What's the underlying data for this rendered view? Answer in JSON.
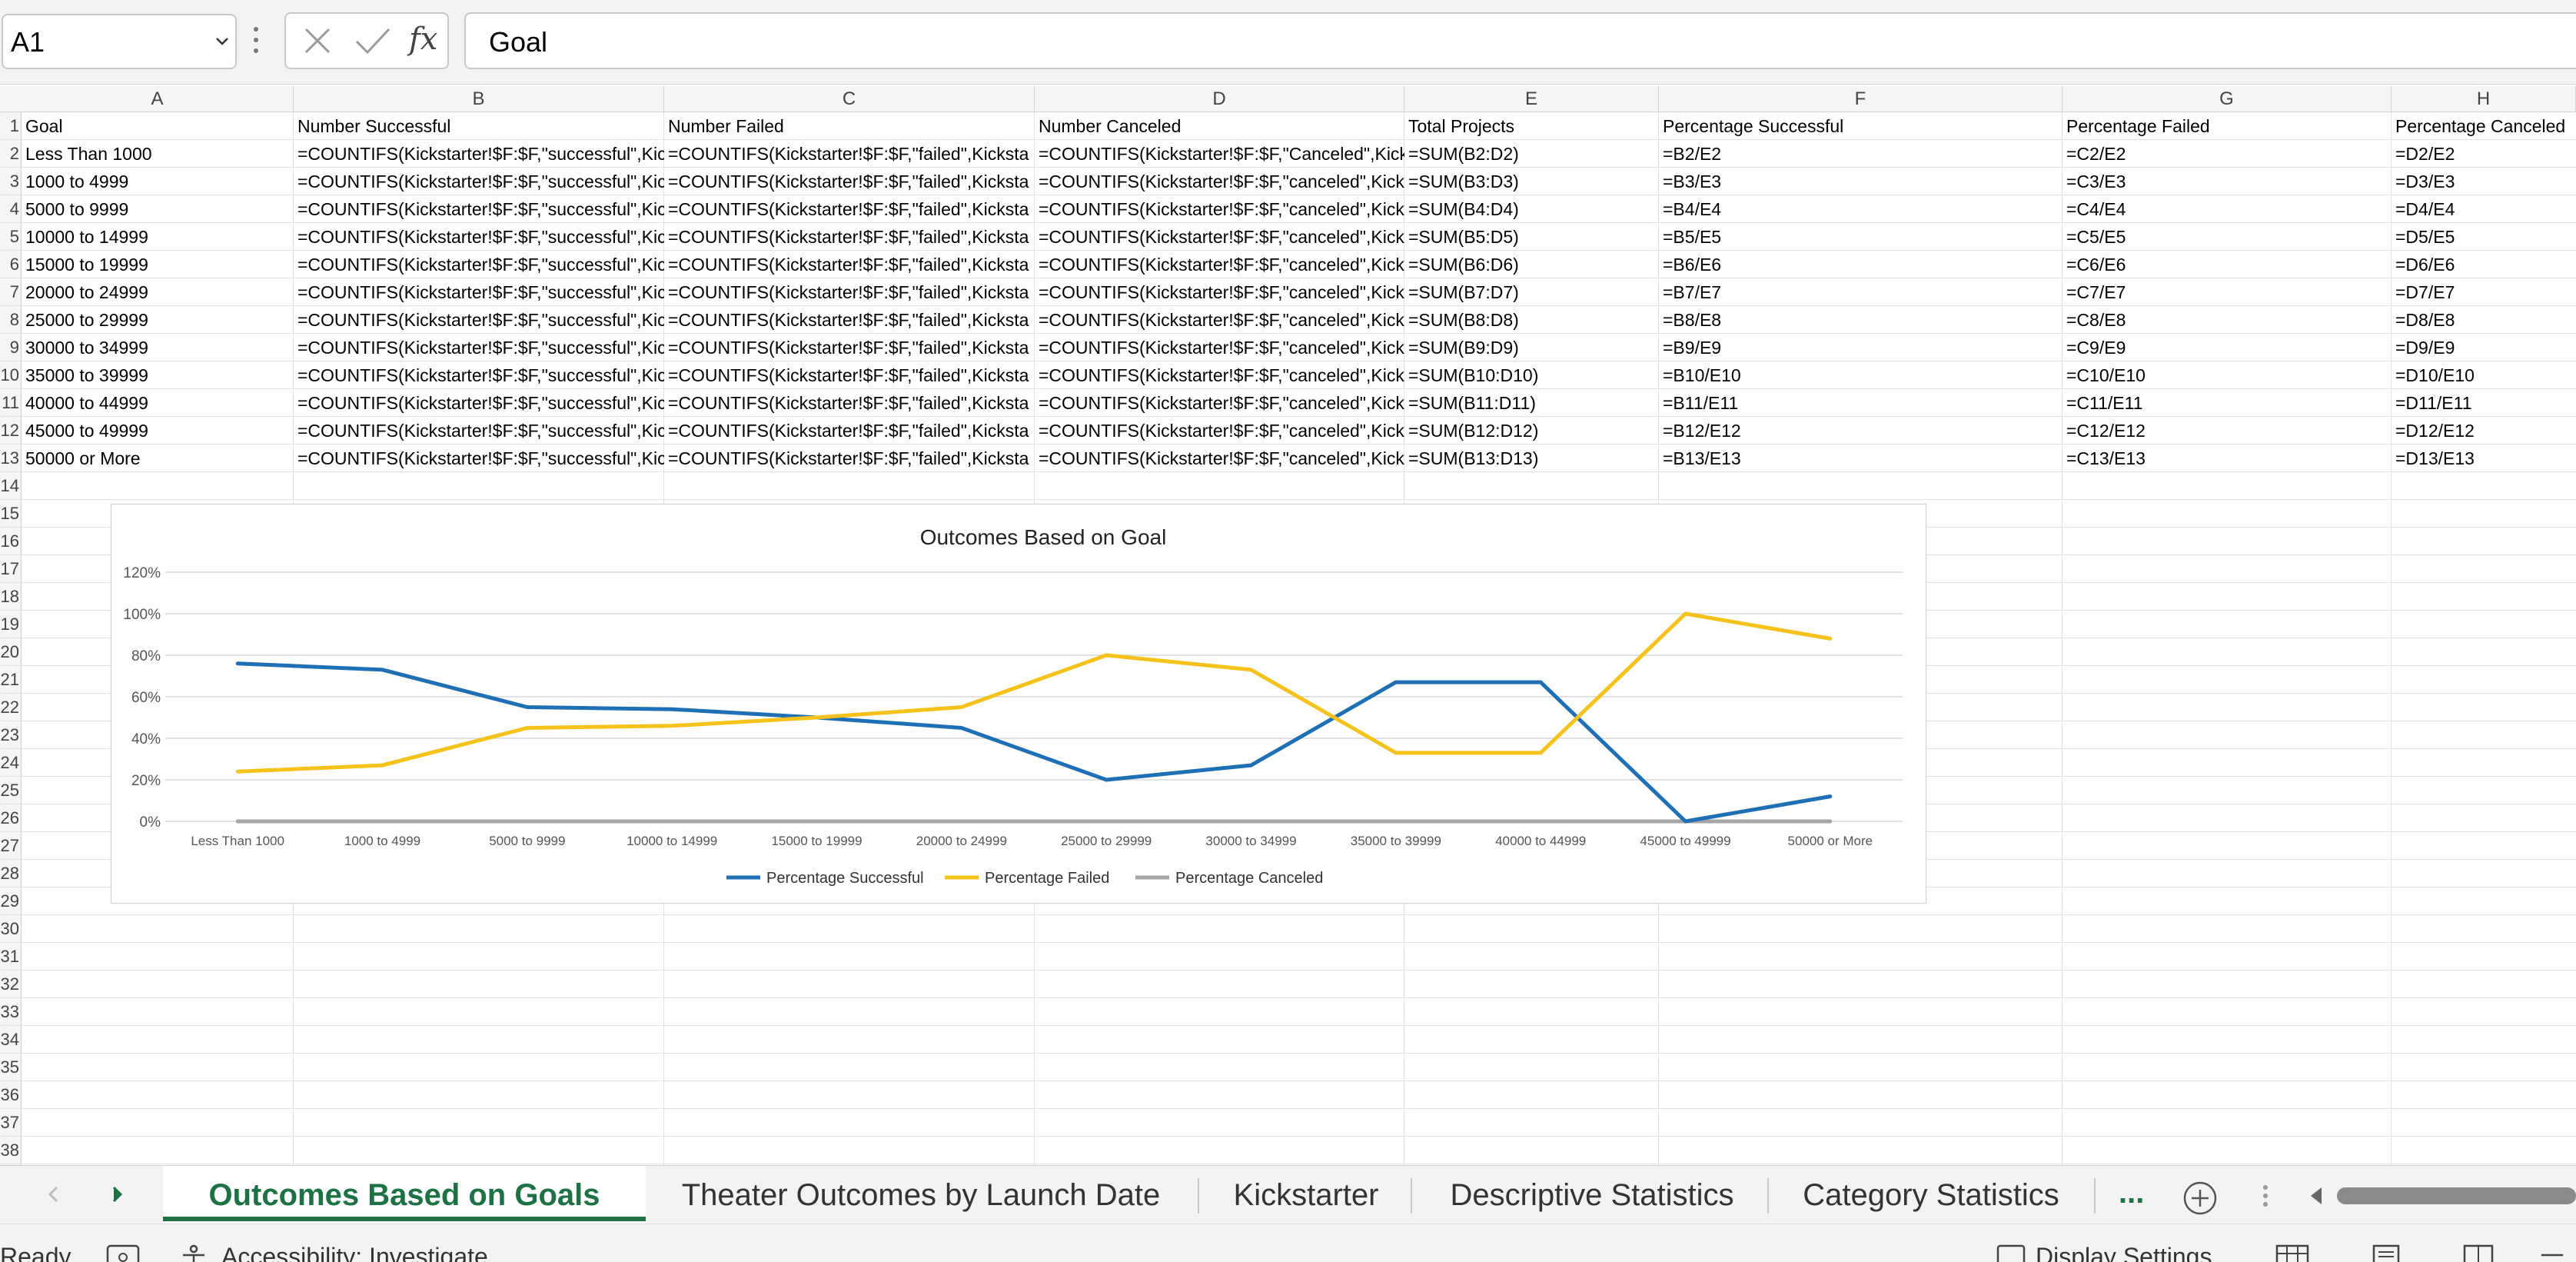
{
  "formula_bar": {
    "name_box": "A1",
    "fx_label": "fx",
    "formula": "Goal"
  },
  "columns": [
    "A",
    "B",
    "C",
    "D",
    "E",
    "F",
    "G",
    "H"
  ],
  "row_numbers": [
    "1",
    "2",
    "3",
    "4",
    "5",
    "6",
    "7",
    "8",
    "9",
    "10",
    "11",
    "12",
    "13",
    "14",
    "15",
    "16",
    "17",
    "18",
    "19",
    "20",
    "21",
    "22",
    "23",
    "24",
    "25",
    "26",
    "27",
    "28",
    "29",
    "30",
    "31",
    "32",
    "33",
    "34",
    "35",
    "36",
    "37",
    "38"
  ],
  "table": {
    "headers": [
      "Goal",
      "Number Successful",
      "Number Failed",
      "Number Canceled",
      "Total Projects",
      "Percentage Successful",
      "Percentage Failed",
      "Percentage Canceled"
    ],
    "rows": [
      [
        "Less Than 1000",
        "=COUNTIFS(Kickstarter!$F:$F,\"successful\",Kic",
        "=COUNTIFS(Kickstarter!$F:$F,\"failed\",Kicksta",
        "=COUNTIFS(Kickstarter!$F:$F,\"Canceled\",Kick",
        "=SUM(B2:D2)",
        "=B2/E2",
        "=C2/E2",
        "=D2/E2"
      ],
      [
        "1000 to 4999",
        "=COUNTIFS(Kickstarter!$F:$F,\"successful\",Kic",
        "=COUNTIFS(Kickstarter!$F:$F,\"failed\",Kicksta",
        "=COUNTIFS(Kickstarter!$F:$F,\"canceled\",Kick",
        "=SUM(B3:D3)",
        "=B3/E3",
        "=C3/E3",
        "=D3/E3"
      ],
      [
        "5000 to 9999",
        "=COUNTIFS(Kickstarter!$F:$F,\"successful\",Kic",
        "=COUNTIFS(Kickstarter!$F:$F,\"failed\",Kicksta",
        "=COUNTIFS(Kickstarter!$F:$F,\"canceled\",Kick",
        "=SUM(B4:D4)",
        "=B4/E4",
        "=C4/E4",
        "=D4/E4"
      ],
      [
        "10000 to 14999",
        "=COUNTIFS(Kickstarter!$F:$F,\"successful\",Kic",
        "=COUNTIFS(Kickstarter!$F:$F,\"failed\",Kicksta",
        "=COUNTIFS(Kickstarter!$F:$F,\"canceled\",Kick",
        "=SUM(B5:D5)",
        "=B5/E5",
        "=C5/E5",
        "=D5/E5"
      ],
      [
        "15000 to 19999",
        "=COUNTIFS(Kickstarter!$F:$F,\"successful\",Kic",
        "=COUNTIFS(Kickstarter!$F:$F,\"failed\",Kicksta",
        "=COUNTIFS(Kickstarter!$F:$F,\"canceled\",Kick",
        "=SUM(B6:D6)",
        "=B6/E6",
        "=C6/E6",
        "=D6/E6"
      ],
      [
        "20000 to 24999",
        "=COUNTIFS(Kickstarter!$F:$F,\"successful\",Kic",
        "=COUNTIFS(Kickstarter!$F:$F,\"failed\",Kicksta",
        "=COUNTIFS(Kickstarter!$F:$F,\"canceled\",Kick",
        "=SUM(B7:D7)",
        "=B7/E7",
        "=C7/E7",
        "=D7/E7"
      ],
      [
        "25000 to 29999",
        "=COUNTIFS(Kickstarter!$F:$F,\"successful\",Kic",
        "=COUNTIFS(Kickstarter!$F:$F,\"failed\",Kicksta",
        "=COUNTIFS(Kickstarter!$F:$F,\"canceled\",Kick",
        "=SUM(B8:D8)",
        "=B8/E8",
        "=C8/E8",
        "=D8/E8"
      ],
      [
        "30000 to 34999",
        "=COUNTIFS(Kickstarter!$F:$F,\"successful\",Kic",
        "=COUNTIFS(Kickstarter!$F:$F,\"failed\",Kicksta",
        "=COUNTIFS(Kickstarter!$F:$F,\"canceled\",Kick",
        "=SUM(B9:D9)",
        "=B9/E9",
        "=C9/E9",
        "=D9/E9"
      ],
      [
        "35000 to 39999",
        "=COUNTIFS(Kickstarter!$F:$F,\"successful\",Kic",
        "=COUNTIFS(Kickstarter!$F:$F,\"failed\",Kicksta",
        "=COUNTIFS(Kickstarter!$F:$F,\"canceled\",Kick",
        "=SUM(B10:D10)",
        "=B10/E10",
        "=C10/E10",
        "=D10/E10"
      ],
      [
        "40000 to 44999",
        "=COUNTIFS(Kickstarter!$F:$F,\"successful\",Kic",
        "=COUNTIFS(Kickstarter!$F:$F,\"failed\",Kicksta",
        "=COUNTIFS(Kickstarter!$F:$F,\"canceled\",Kick",
        "=SUM(B11:D11)",
        "=B11/E11",
        "=C11/E11",
        "=D11/E11"
      ],
      [
        "45000 to 49999",
        "=COUNTIFS(Kickstarter!$F:$F,\"successful\",Kic",
        "=COUNTIFS(Kickstarter!$F:$F,\"failed\",Kicksta",
        "=COUNTIFS(Kickstarter!$F:$F,\"canceled\",Kick",
        "=SUM(B12:D12)",
        "=B12/E12",
        "=C12/E12",
        "=D12/E12"
      ],
      [
        "50000 or More",
        "=COUNTIFS(Kickstarter!$F:$F,\"successful\",Kic",
        "=COUNTIFS(Kickstarter!$F:$F,\"failed\",Kicksta",
        "=COUNTIFS(Kickstarter!$F:$F,\"canceled\",Kick",
        "=SUM(B13:D13)",
        "=B13/E13",
        "=C13/E13",
        "=D13/E13"
      ]
    ]
  },
  "chart_data": {
    "type": "line",
    "title": "Outcomes Based on Goal",
    "categories": [
      "Less Than 1000",
      "1000 to 4999",
      "5000 to 9999",
      "10000 to 14999",
      "15000 to 19999",
      "20000 to 24999",
      "25000 to 29999",
      "30000 to 34999",
      "35000 to 39999",
      "40000 to 44999",
      "45000 to 49999",
      "50000 or More"
    ],
    "series": [
      {
        "name": "Percentage Successful",
        "color": "#1f6fb5",
        "values": [
          0.76,
          0.73,
          0.55,
          0.54,
          0.5,
          0.45,
          0.2,
          0.27,
          0.67,
          0.67,
          0.0,
          0.12
        ]
      },
      {
        "name": "Percentage Failed",
        "color": "#f5c21b",
        "values": [
          0.24,
          0.27,
          0.45,
          0.46,
          0.5,
          0.55,
          0.8,
          0.73,
          0.33,
          0.33,
          1.0,
          0.88
        ]
      },
      {
        "name": "Percentage Canceled",
        "color": "#a6a6a6",
        "values": [
          0,
          0,
          0,
          0,
          0,
          0,
          0,
          0,
          0,
          0,
          0,
          0
        ]
      }
    ],
    "y_ticks": [
      "0%",
      "20%",
      "40%",
      "60%",
      "80%",
      "100%",
      "120%"
    ],
    "ylim": [
      0,
      1.2
    ],
    "grid": true,
    "legend": "bottom"
  },
  "sheet_tabs": {
    "active": "Outcomes Based on Goals",
    "others": [
      "Theater Outcomes by Launch Date",
      "Kickstarter",
      "Descriptive Statistics",
      "Category Statistics"
    ],
    "more_label": "..."
  },
  "status_bar": {
    "ready": "Ready",
    "accessibility": "Accessibility: Investigate",
    "display_settings": "Display Settings"
  },
  "colors": {
    "accent": "#1e7145",
    "successful": "#1f6fb5",
    "failed": "#f5c21b",
    "canceled": "#a6a6a6"
  }
}
